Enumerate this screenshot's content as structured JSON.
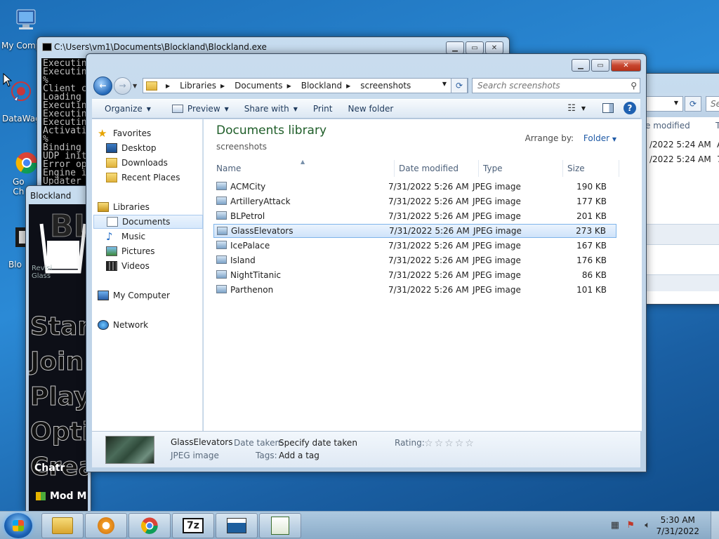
{
  "desktop": {
    "icons": [
      {
        "label": "My Comp"
      },
      {
        "label": "DataWag"
      },
      {
        "label": "Go\nCh"
      },
      {
        "label": "Blo"
      }
    ]
  },
  "console": {
    "title": "C:\\Users\\vm1\\Documents\\Blockland\\Blockland.exe",
    "lines": [
      "Executin",
      "Executin",
      "%",
      "Client c",
      "Loading ",
      "Executin",
      "Executin",
      "Executin",
      "Activati",
      "%",
      "Binding ",
      "UDP init",
      "Error op",
      "Engine i",
      "Updater "
    ]
  },
  "game": {
    "title": "Blockland",
    "menu": [
      "Star",
      "Join",
      "Play",
      "Opti",
      "Crea"
    ],
    "chat": "Chatr",
    "mod": "Mod M",
    "logo_lines": [
      "Revisi",
      "Glass"
    ]
  },
  "explorer": {
    "breadcrumb": [
      "Libraries",
      "Documents",
      "Blockland",
      "screenshots"
    ],
    "search_placeholder": "Search screenshots",
    "toolbar": {
      "organize": "Organize",
      "preview": "Preview",
      "share_with": "Share with",
      "print": "Print",
      "new_folder": "New folder"
    },
    "nav": {
      "favorites": "Favorites",
      "desktop": "Desktop",
      "downloads": "Downloads",
      "recent_places": "Recent Places",
      "libraries": "Libraries",
      "documents": "Documents",
      "music": "Music",
      "pictures": "Pictures",
      "videos": "Videos",
      "my_computer": "My Computer",
      "network": "Network"
    },
    "library_title": "Documents library",
    "library_sub": "screenshots",
    "arrange_label": "Arrange by:",
    "arrange_value": "Folder",
    "columns": {
      "name": "Name",
      "date": "Date modified",
      "type": "Type",
      "size": "Size"
    },
    "files": [
      {
        "name": "ACMCity",
        "date": "7/31/2022 5:26 AM",
        "type": "JPEG image",
        "size": "190 KB"
      },
      {
        "name": "ArtilleryAttack",
        "date": "7/31/2022 5:26 AM",
        "type": "JPEG image",
        "size": "177 KB"
      },
      {
        "name": "BLPetrol",
        "date": "7/31/2022 5:26 AM",
        "type": "JPEG image",
        "size": "201 KB"
      },
      {
        "name": "GlassElevators",
        "date": "7/31/2022 5:26 AM",
        "type": "JPEG image",
        "size": "273 KB"
      },
      {
        "name": "IcePalace",
        "date": "7/31/2022 5:26 AM",
        "type": "JPEG image",
        "size": "167 KB"
      },
      {
        "name": "Island",
        "date": "7/31/2022 5:26 AM",
        "type": "JPEG image",
        "size": "176 KB"
      },
      {
        "name": "NightTitanic",
        "date": "7/31/2022 5:26 AM",
        "type": "JPEG image",
        "size": "86 KB"
      },
      {
        "name": "Parthenon",
        "date": "7/31/2022 5:26 AM",
        "type": "JPEG image",
        "size": "101 KB"
      }
    ],
    "selected_index": 3,
    "details": {
      "name": "GlassElevators",
      "type": "JPEG image",
      "date_taken_label": "Date taken:",
      "date_taken_value": "Specify date taken",
      "tags_label": "Tags:",
      "tags_value": "Add a tag",
      "rating_label": "Rating:",
      "rating_value": 0
    }
  },
  "background_window": {
    "column": "e modified",
    "column2": "T",
    "rows": [
      {
        "date": "/2022 5:24 AM",
        "extra": "A"
      },
      {
        "date": "/2022 5:24 AM",
        "extra": "7"
      }
    ],
    "search_stub": "Se"
  },
  "taskbar": {
    "time": "5:30 AM",
    "date": "7/31/2022"
  },
  "colors": {
    "library_title": "#1e5d28",
    "selection": "#cfe3fa",
    "link_blue": "#1f5aa6"
  }
}
